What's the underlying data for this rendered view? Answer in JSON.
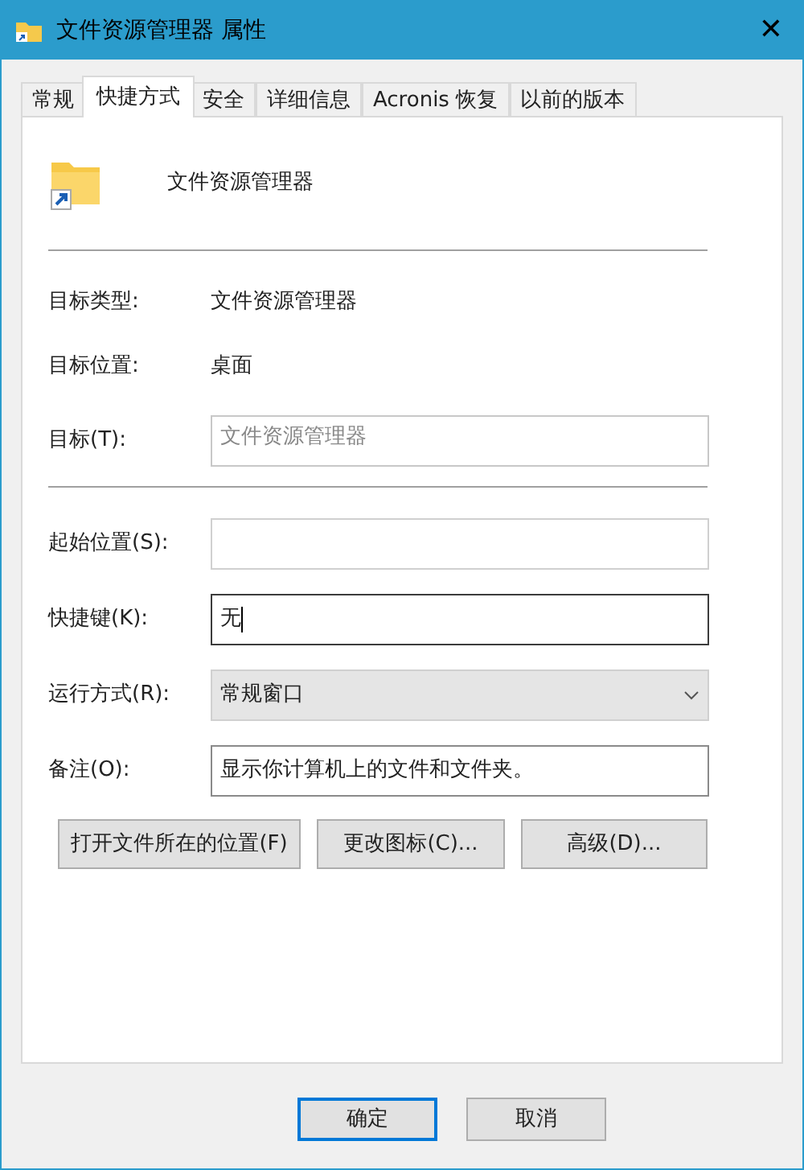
{
  "window": {
    "title": "文件资源管理器 属性",
    "close": "✕"
  },
  "tabs": [
    {
      "label": "常规",
      "selected": false
    },
    {
      "label": "快捷方式",
      "selected": true
    },
    {
      "label": "安全",
      "selected": false
    },
    {
      "label": "详细信息",
      "selected": false
    },
    {
      "label": "Acronis 恢复",
      "selected": false
    },
    {
      "label": "以前的版本",
      "selected": false
    }
  ],
  "shortcut": {
    "name": "文件资源管理器"
  },
  "info": [
    {
      "label": "目标类型:",
      "value": "文件资源管理器"
    },
    {
      "label": "目标位置:",
      "value": "桌面"
    }
  ],
  "target": {
    "label": "目标(T):",
    "value": "文件资源管理器",
    "disabled": true
  },
  "fields": [
    {
      "kind": "text",
      "label": "起始位置(S):",
      "focused": false
    },
    {
      "kind": "text",
      "label": "快捷键(K):",
      "value": "无",
      "focused": true
    },
    {
      "kind": "select",
      "label": "运行方式(R):",
      "value": "常规窗口"
    },
    {
      "kind": "text",
      "label": "备注(O):",
      "value": "显示你计算机上的文件和文件夹。",
      "focused": false
    }
  ],
  "buttons": [
    "打开文件所在的位置(F)",
    "更改图标(C)...",
    "高级(D)..."
  ],
  "dialog_buttons": [
    {
      "label": "确定",
      "default": true
    },
    {
      "label": "取消",
      "default": false
    }
  ]
}
